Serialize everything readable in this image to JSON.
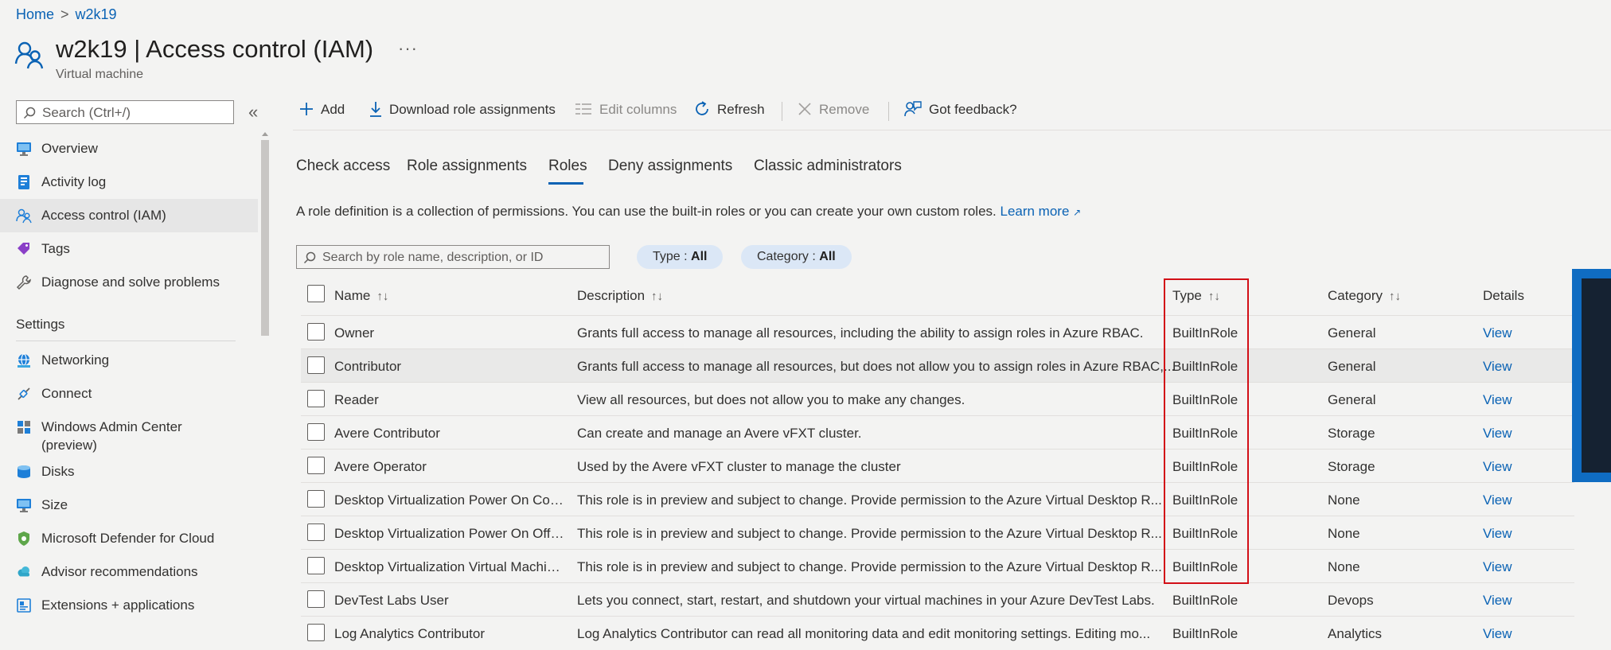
{
  "breadcrumb": {
    "home": "Home",
    "separator": ">",
    "current": "w2k19"
  },
  "header": {
    "title": "w2k19 | Access control (IAM)",
    "more": "···",
    "subtitle": "Virtual machine"
  },
  "sidebar": {
    "search_placeholder": "Search (Ctrl+/)",
    "collapse": "«",
    "items": [
      {
        "label": "Overview",
        "icon": "monitor-icon"
      },
      {
        "label": "Activity log",
        "icon": "log-icon"
      },
      {
        "label": "Access control (IAM)",
        "icon": "people-icon",
        "active": true
      },
      {
        "label": "Tags",
        "icon": "tag-icon"
      },
      {
        "label": "Diagnose and solve problems",
        "icon": "wrench-icon"
      }
    ],
    "settings_header": "Settings",
    "settings_items": [
      {
        "label": "Networking",
        "icon": "network-icon"
      },
      {
        "label": "Connect",
        "icon": "connect-icon"
      },
      {
        "label": "Windows Admin Center (preview)",
        "icon": "admin-center-icon"
      },
      {
        "label": "Disks",
        "icon": "disks-icon"
      },
      {
        "label": "Size",
        "icon": "monitor-icon"
      },
      {
        "label": "Microsoft Defender for Cloud",
        "icon": "shield-icon"
      },
      {
        "label": "Advisor recommendations",
        "icon": "cloud-icon"
      },
      {
        "label": "Extensions + applications",
        "icon": "extensions-icon"
      }
    ]
  },
  "toolbar": {
    "add": "Add",
    "download": "Download role assignments",
    "edit_columns": "Edit columns",
    "refresh": "Refresh",
    "remove": "Remove",
    "feedback": "Got feedback?"
  },
  "tabs": [
    "Check access",
    "Role assignments",
    "Roles",
    "Deny assignments",
    "Classic administrators"
  ],
  "active_tab": "Roles",
  "intro": {
    "text": "A role definition is a collection of permissions. You can use the built-in roles or you can create your own custom roles.",
    "link": "Learn more"
  },
  "filters": {
    "search_placeholder": "Search by role name, description, or ID",
    "type_label": "Type : ",
    "type_value": "All",
    "category_label": "Category : ",
    "category_value": "All"
  },
  "table": {
    "columns": {
      "name": "Name",
      "description": "Description",
      "type": "Type",
      "category": "Category",
      "details": "Details"
    },
    "sort_glyph": "↑↓",
    "rows": [
      {
        "name": "Owner",
        "description": "Grants full access to manage all resources, including the ability to assign roles in Azure RBAC.",
        "type": "BuiltInRole",
        "category": "General",
        "details": "View"
      },
      {
        "name": "Contributor",
        "description": "Grants full access to manage all resources, but does not allow you to assign roles in Azure RBAC,...",
        "type": "BuiltInRole",
        "category": "General",
        "details": "View"
      },
      {
        "name": "Reader",
        "description": "View all resources, but does not allow you to make any changes.",
        "type": "BuiltInRole",
        "category": "General",
        "details": "View"
      },
      {
        "name": "Avere Contributor",
        "description": "Can create and manage an Avere vFXT cluster.",
        "type": "BuiltInRole",
        "category": "Storage",
        "details": "View"
      },
      {
        "name": "Avere Operator",
        "description": "Used by the Avere vFXT cluster to manage the cluster",
        "type": "BuiltInRole",
        "category": "Storage",
        "details": "View"
      },
      {
        "name": "Desktop Virtualization Power On Con...",
        "description": "This role is in preview and subject to change. Provide permission to the Azure Virtual Desktop R...",
        "type": "BuiltInRole",
        "category": "None",
        "details": "View"
      },
      {
        "name": "Desktop Virtualization Power On Off ...",
        "description": "This role is in preview and subject to change. Provide permission to the Azure Virtual Desktop R...",
        "type": "BuiltInRole",
        "category": "None",
        "details": "View"
      },
      {
        "name": "Desktop Virtualization Virtual Machin...",
        "description": "This role is in preview and subject to change. Provide permission to the Azure Virtual Desktop R...",
        "type": "BuiltInRole",
        "category": "None",
        "details": "View"
      },
      {
        "name": "DevTest Labs User",
        "description": "Lets you connect, start, restart, and shutdown your virtual machines in your Azure DevTest Labs.",
        "type": "BuiltInRole",
        "category": "Devops",
        "details": "View"
      },
      {
        "name": "Log Analytics Contributor",
        "description": "Log Analytics Contributor can read all monitoring data and edit monitoring settings. Editing mo...",
        "type": "BuiltInRole",
        "category": "Analytics",
        "details": "View"
      }
    ]
  },
  "colors": {
    "accent": "#0a62b4",
    "highlight_box": "#d20f17",
    "pill": "#dbe7f6"
  }
}
